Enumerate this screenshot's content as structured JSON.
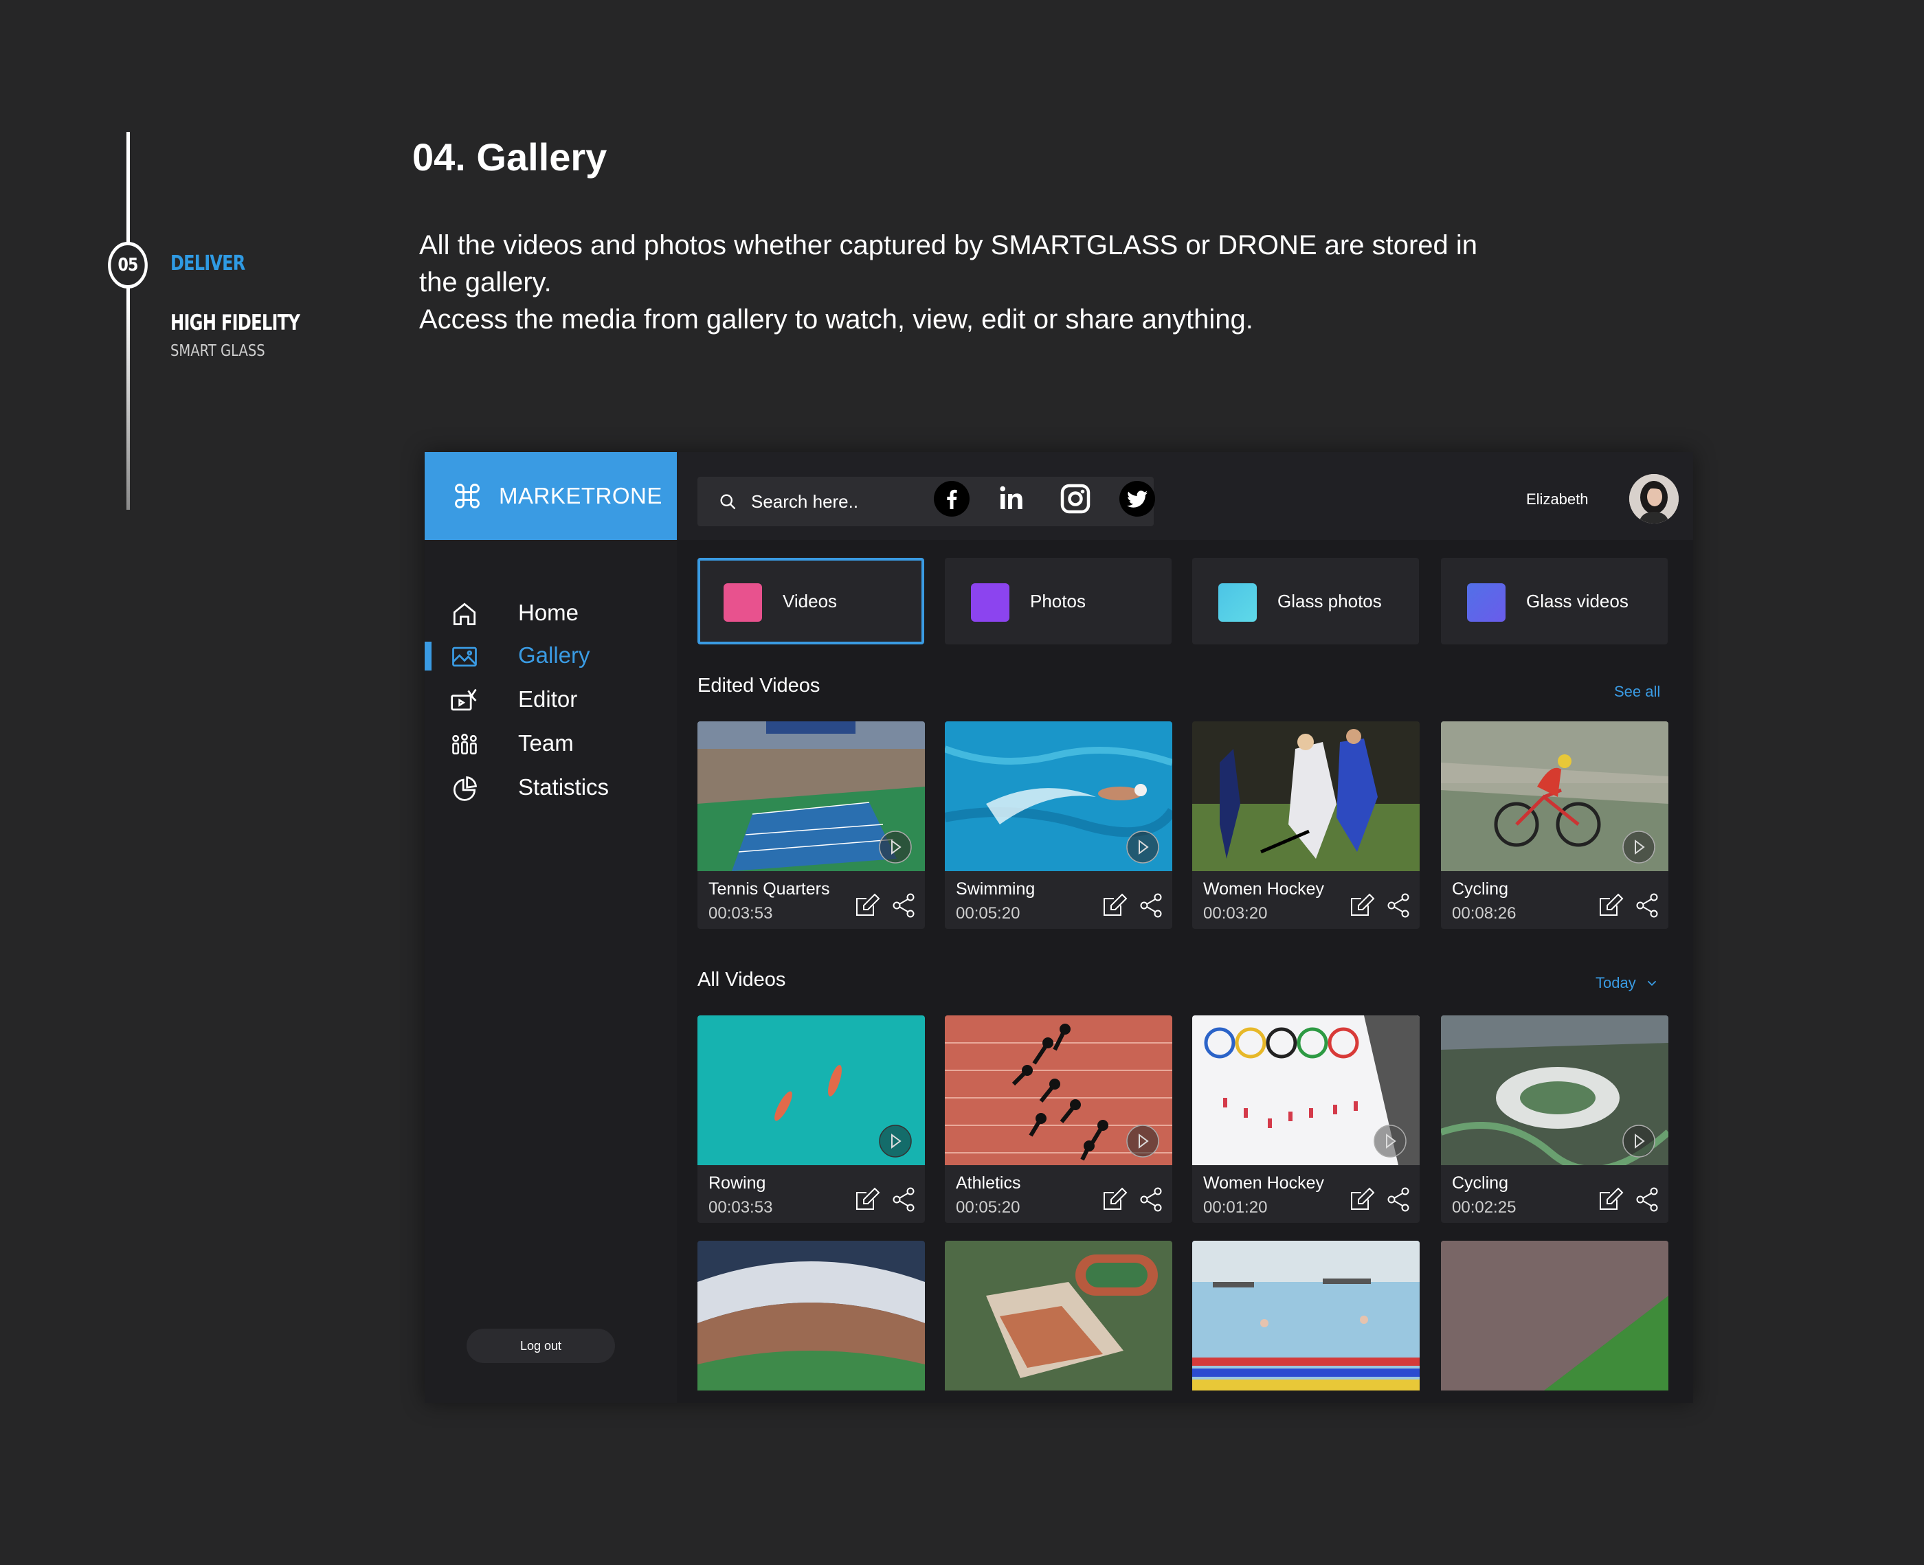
{
  "progress": {
    "step_number": "05",
    "step_label": "DELIVER",
    "stage_title": "HIGH FIDELITY",
    "stage_subtitle": "SMART GLASS"
  },
  "header": {
    "title": "04. Gallery",
    "description_lines": [
      "All the videos and photos whether captured by SMARTGLASS or DRONE are stored in",
      "the gallery.",
      "Access the media from gallery to watch, view, edit or share anything."
    ]
  },
  "app": {
    "brand": "MARKETRONE",
    "search_placeholder": "Search here..",
    "social_icons": [
      "facebook-icon",
      "linkedin-icon",
      "instagram-icon",
      "twitter-icon"
    ],
    "user_name": "Elizabeth",
    "nav": [
      {
        "label": "Home",
        "icon": "home-icon",
        "active": false
      },
      {
        "label": "Gallery",
        "icon": "gallery-icon",
        "active": true
      },
      {
        "label": "Editor",
        "icon": "editor-icon",
        "active": false
      },
      {
        "label": "Team",
        "icon": "team-icon",
        "active": false
      },
      {
        "label": "Statistics",
        "icon": "statistics-icon",
        "active": false
      }
    ],
    "logout_label": "Log out",
    "categories": [
      {
        "label": "Videos",
        "color": "#e8528e",
        "selected": true
      },
      {
        "label": "Photos",
        "color": "#8c44ef",
        "selected": false
      },
      {
        "label": "Glass photos",
        "color": "#4cc4e6",
        "selected": false
      },
      {
        "label": "Glass videos",
        "color": "#5270e8",
        "selected": false
      }
    ],
    "edited": {
      "heading": "Edited Videos",
      "link": "See all",
      "items": [
        {
          "title": "Tennis Quarters",
          "duration": "00:03:53"
        },
        {
          "title": "Swimming",
          "duration": "00:05:20"
        },
        {
          "title": "Women Hockey",
          "duration": "00:03:20"
        },
        {
          "title": "Cycling",
          "duration": "00:08:26"
        }
      ]
    },
    "all": {
      "heading": "All Videos",
      "filter": "Today",
      "items": [
        {
          "title": "Rowing",
          "duration": "00:03:53"
        },
        {
          "title": "Athletics",
          "duration": "00:05:20"
        },
        {
          "title": "Women Hockey",
          "duration": "00:01:20"
        },
        {
          "title": "Cycling",
          "duration": "00:02:25"
        }
      ]
    },
    "accent_color": "#3a9be3"
  }
}
